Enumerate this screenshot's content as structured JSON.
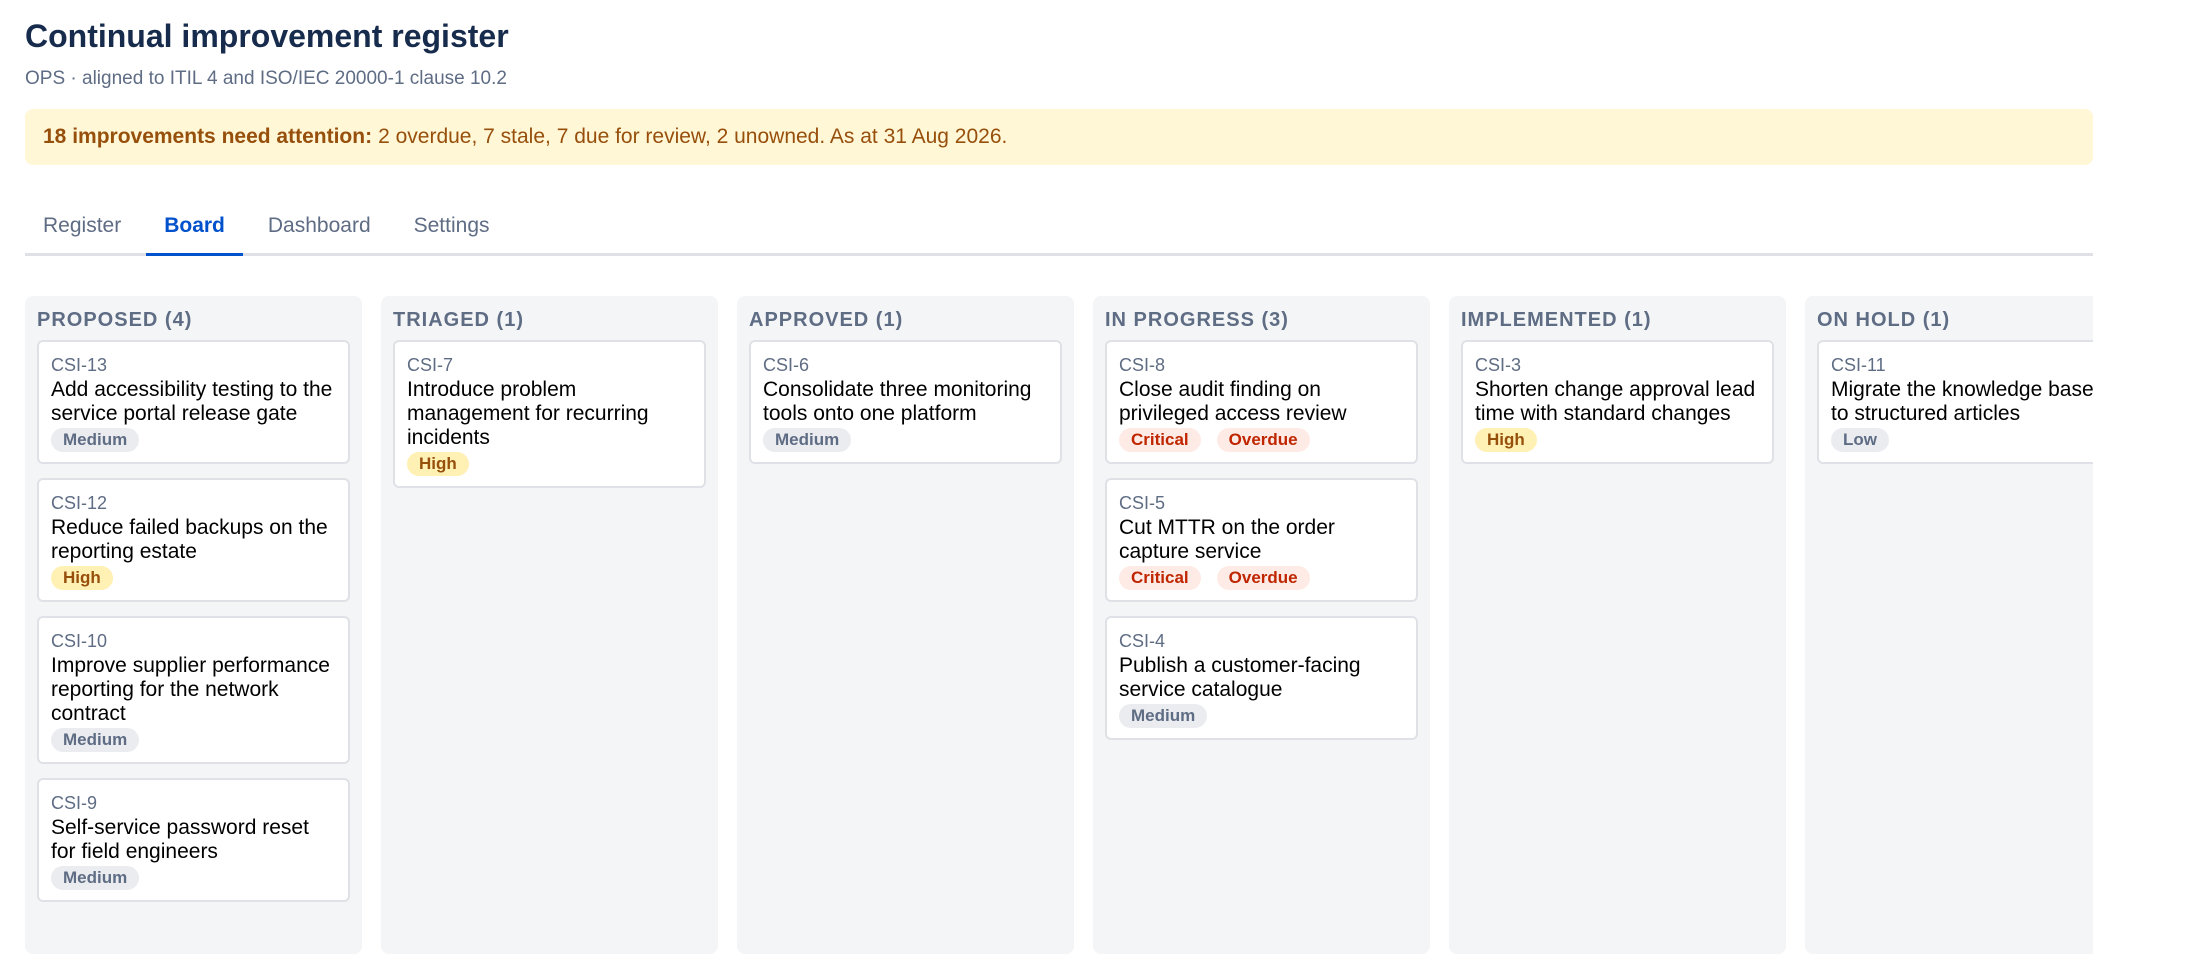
{
  "header": {
    "title": "Continual improvement register",
    "subtitle": "OPS · aligned to ITIL 4 and ISO/IEC 20000-1 clause 10.2"
  },
  "alert": {
    "strong": "18 improvements need attention:",
    "text": "2 overdue, 7 stale, 7 due for review, 2 unowned. As at 31 Aug 2026."
  },
  "tabs": [
    {
      "label": "Register",
      "active": false
    },
    {
      "label": "Board",
      "active": true
    },
    {
      "label": "Dashboard",
      "active": false
    },
    {
      "label": "Settings",
      "active": false
    }
  ],
  "columns": [
    {
      "header": "PROPOSED (4)",
      "cards": [
        {
          "id": "CSI-13",
          "title": "Add accessibility testing to the service portal release gate",
          "badges": [
            {
              "label": "Medium",
              "kind": "medium"
            }
          ]
        },
        {
          "id": "CSI-12",
          "title": "Reduce failed backups on the reporting estate",
          "badges": [
            {
              "label": "High",
              "kind": "high"
            }
          ]
        },
        {
          "id": "CSI-10",
          "title": "Improve supplier performance reporting for the network contract",
          "badges": [
            {
              "label": "Medium",
              "kind": "medium"
            }
          ]
        },
        {
          "id": "CSI-9",
          "title": "Self-service password reset for field engineers",
          "badges": [
            {
              "label": "Medium",
              "kind": "medium"
            }
          ]
        }
      ]
    },
    {
      "header": "TRIAGED (1)",
      "cards": [
        {
          "id": "CSI-7",
          "title": "Introduce problem management for recurring incidents",
          "badges": [
            {
              "label": "High",
              "kind": "high"
            }
          ]
        }
      ]
    },
    {
      "header": "APPROVED (1)",
      "cards": [
        {
          "id": "CSI-6",
          "title": "Consolidate three monitoring tools onto one platform",
          "badges": [
            {
              "label": "Medium",
              "kind": "medium"
            }
          ]
        }
      ]
    },
    {
      "header": "IN PROGRESS (3)",
      "cards": [
        {
          "id": "CSI-8",
          "title": "Close audit finding on privileged access review",
          "badges": [
            {
              "label": "Critical",
              "kind": "critical"
            },
            {
              "label": "Overdue",
              "kind": "overdue"
            }
          ]
        },
        {
          "id": "CSI-5",
          "title": "Cut MTTR on the order capture service",
          "badges": [
            {
              "label": "Critical",
              "kind": "critical"
            },
            {
              "label": "Overdue",
              "kind": "overdue"
            }
          ]
        },
        {
          "id": "CSI-4",
          "title": "Publish a customer-facing service catalogue",
          "badges": [
            {
              "label": "Medium",
              "kind": "medium"
            }
          ]
        }
      ]
    },
    {
      "header": "IMPLEMENTED (1)",
      "cards": [
        {
          "id": "CSI-3",
          "title": "Shorten change approval lead time with standard changes",
          "badges": [
            {
              "label": "High",
              "kind": "high"
            }
          ]
        }
      ]
    },
    {
      "header": "ON HOLD (1)",
      "cards": [
        {
          "id": "CSI-11",
          "title": "Migrate the knowledge base to structured articles",
          "badges": [
            {
              "label": "Low",
              "kind": "low"
            }
          ]
        }
      ]
    }
  ]
}
